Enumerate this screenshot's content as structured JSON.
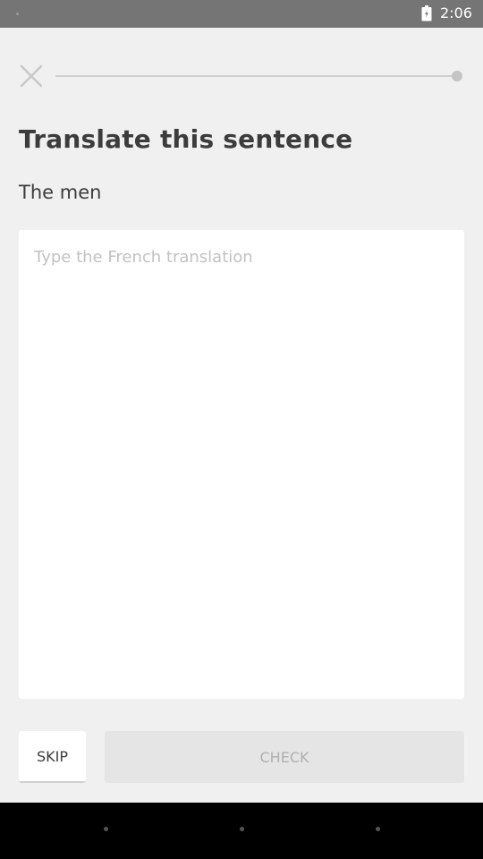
{
  "status_bar": {
    "time": "2:06"
  },
  "header": {
    "close_icon": "close-icon",
    "progress_fraction": 0.0
  },
  "exercise": {
    "title": "Translate this sentence",
    "prompt": "The men",
    "input_placeholder": "Type the French translation",
    "input_value": ""
  },
  "footer": {
    "skip_label": "SKIP",
    "check_label": "CHECK"
  },
  "colors": {
    "background": "#f0f0f0",
    "status_bar": "#757575",
    "text": "#3c3c3c",
    "disabled_button": "#e5e5e5",
    "disabled_text": "#b0b0b0"
  }
}
